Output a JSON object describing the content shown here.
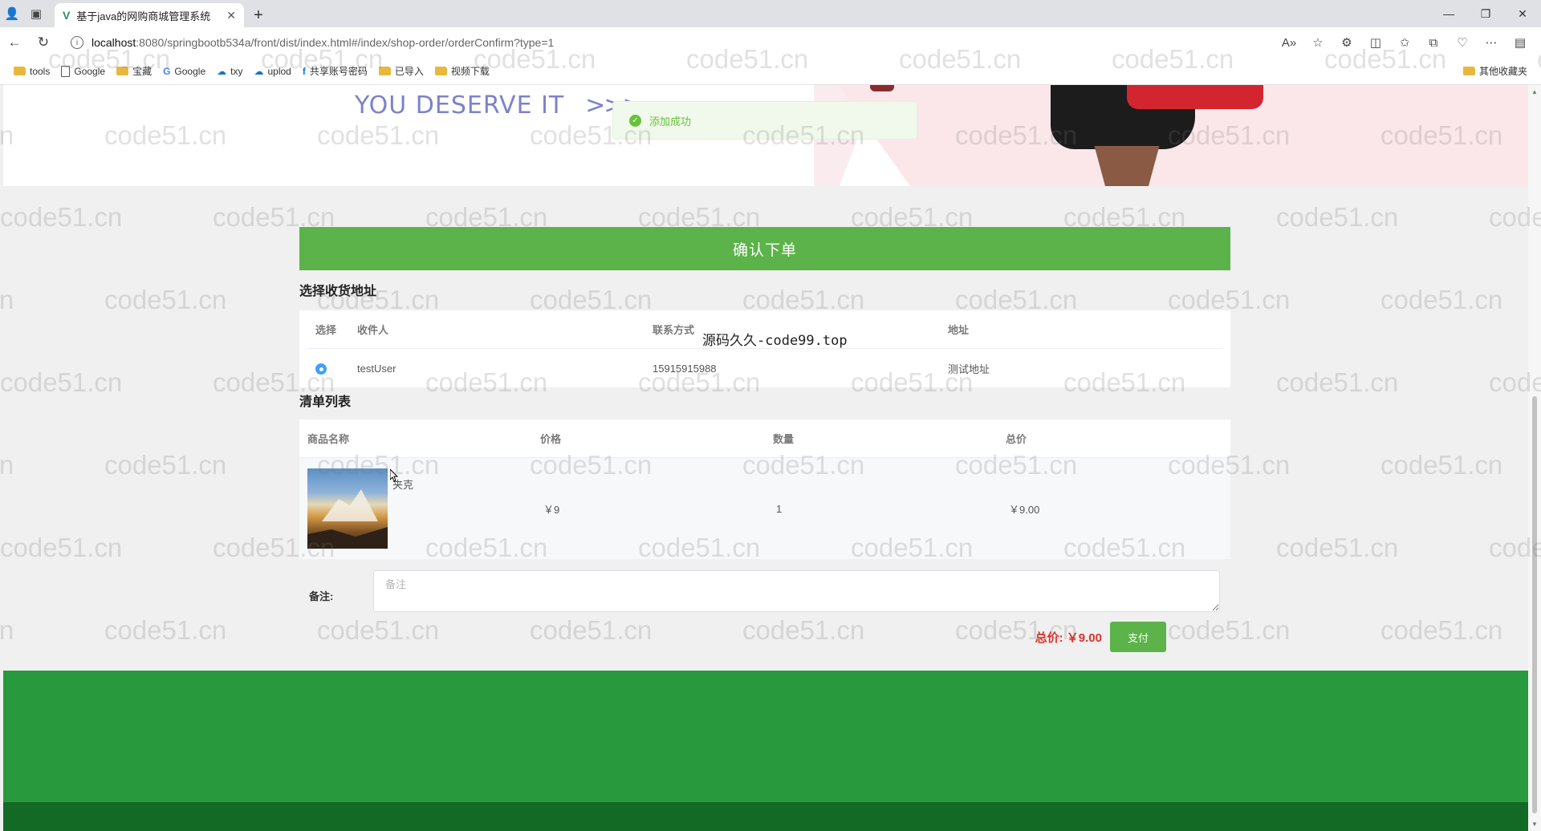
{
  "browser": {
    "tab_title": "基于java的网购商城管理系统",
    "url_host": "localhost",
    "url_path": ":8080/springbootb534a/front/dist/index.html#/index/shop-order/orderConfirm?type=1",
    "bookmarks": [
      {
        "icon": "folder-icon",
        "label": "tools"
      },
      {
        "icon": "page-icon",
        "label": "Google"
      },
      {
        "icon": "folder-icon",
        "label": "宝藏"
      },
      {
        "icon": "google-icon",
        "label": "Google"
      },
      {
        "icon": "cloud-icon",
        "label": "txy"
      },
      {
        "icon": "cloud-icon",
        "label": "uplod"
      },
      {
        "icon": "facebook-icon",
        "label": "共享账号密码"
      },
      {
        "icon": "folder-icon",
        "label": "已导入"
      },
      {
        "icon": "folder-icon",
        "label": "视频下载"
      }
    ],
    "other_bookmarks": "其他收藏夹"
  },
  "banner": {
    "slogan": "YOU DESERVE IT",
    "chevrons": ">>>"
  },
  "toast": {
    "message": "添加成功"
  },
  "order": {
    "header": "确认下单",
    "address_section_title": "选择收货地址",
    "address_columns": {
      "select": "选择",
      "receiver": "收件人",
      "phone": "联系方式",
      "address": "地址"
    },
    "address_rows": [
      {
        "receiver": "testUser",
        "phone": "15915915988",
        "address": "测试地址"
      }
    ],
    "list_section_title": "清单列表",
    "list_columns": {
      "name": "商品名称",
      "price": "价格",
      "qty": "数量",
      "total": "总价"
    },
    "list_rows": [
      {
        "name": "夹克",
        "price": "￥9",
        "qty": "1",
        "total": "￥9.00"
      }
    ],
    "remark_label": "备注:",
    "remark_placeholder": "备注",
    "total_label": "总价:",
    "total_value": "￥9.00",
    "pay_button": "支付"
  },
  "overlay_text": "源码久久-code99.top",
  "watermark": "code51.cn",
  "colors": {
    "accent_green": "#5bb349",
    "footer_green": "#28993d",
    "footer_dark": "#126a25",
    "price_red": "#e0312b",
    "toast_green": "#67c23a"
  }
}
